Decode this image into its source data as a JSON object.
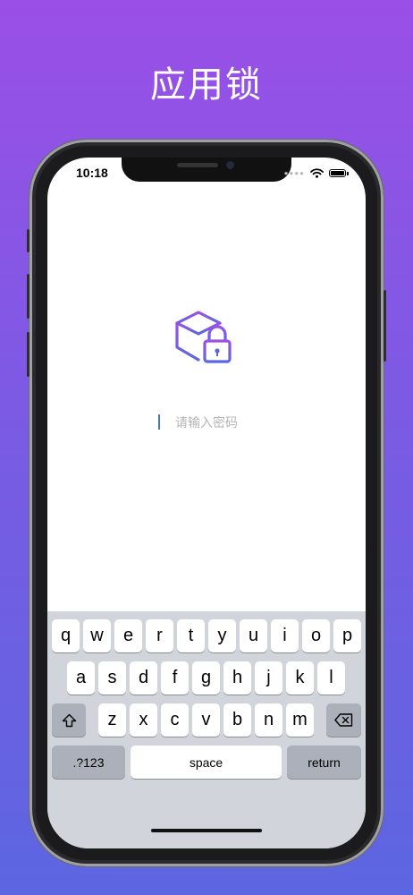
{
  "promo": {
    "title": "应用锁"
  },
  "status_bar": {
    "time": "10:18"
  },
  "lock_screen": {
    "password_placeholder": "请输入密码"
  },
  "keyboard": {
    "row1": [
      "q",
      "w",
      "e",
      "r",
      "t",
      "y",
      "u",
      "i",
      "o",
      "p"
    ],
    "row2": [
      "a",
      "s",
      "d",
      "f",
      "g",
      "h",
      "j",
      "k",
      "l"
    ],
    "row3": [
      "z",
      "x",
      "c",
      "v",
      "b",
      "n",
      "m"
    ],
    "numbers_key": ".?123",
    "space_key": "space",
    "return_key": "return",
    "shift_icon": "shift-icon",
    "delete_icon": "backspace-icon"
  },
  "colors": {
    "background_top": "#9a4fe6",
    "background_bottom": "#5c66e0",
    "logo_purple": "#9b4fe3",
    "logo_blue": "#5a67e0"
  }
}
